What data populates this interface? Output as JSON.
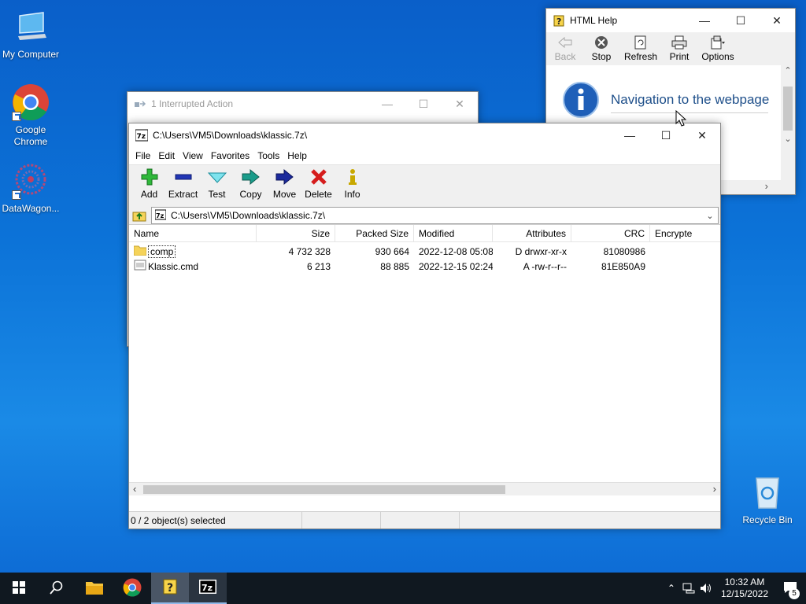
{
  "desktop": {
    "icons": [
      {
        "label": "My Computer"
      },
      {
        "label": "Google Chrome"
      },
      {
        "label": "DataWagon..."
      },
      {
        "label": "Recycle Bin"
      }
    ]
  },
  "html_help": {
    "title": "HTML Help",
    "buttons": [
      {
        "label": "Back",
        "icon": "back-arrow-icon"
      },
      {
        "label": "Stop",
        "icon": "stop-icon"
      },
      {
        "label": "Refresh",
        "icon": "refresh-icon"
      },
      {
        "label": "Print",
        "icon": "printer-icon"
      },
      {
        "label": "Options",
        "icon": "options-icon"
      }
    ],
    "message": "Navigation to the webpage"
  },
  "interrupted": {
    "title": "1 Interrupted Action"
  },
  "sevenzip": {
    "title": "C:\\Users\\VM5\\Downloads\\klassic.7z\\",
    "menu": [
      "File",
      "Edit",
      "View",
      "Favorites",
      "Tools",
      "Help"
    ],
    "toolbar": [
      {
        "label": "Add",
        "icon": "plus-icon",
        "color": "#2fb83a"
      },
      {
        "label": "Extract",
        "icon": "minus-icon",
        "color": "#2136b5"
      },
      {
        "label": "Test",
        "icon": "check-icon",
        "color": "#21b5c5"
      },
      {
        "label": "Copy",
        "icon": "copy-arrow-icon",
        "color": "#1a9c8a"
      },
      {
        "label": "Move",
        "icon": "move-arrow-icon",
        "color": "#1c2a9c"
      },
      {
        "label": "Delete",
        "icon": "delete-x-icon",
        "color": "#d51c1c"
      },
      {
        "label": "Info",
        "icon": "info-icon",
        "color": "#c8a800"
      }
    ],
    "address": "C:\\Users\\VM5\\Downloads\\klassic.7z\\",
    "columns": [
      "Name",
      "Size",
      "Packed Size",
      "Modified",
      "Attributes",
      "CRC",
      "Encrypte"
    ],
    "rows": [
      {
        "name": "comp",
        "size": "4 732 328",
        "packed": "930 664",
        "modified": "2022-12-08 05:08",
        "attributes": "D drwxr-xr-x",
        "crc": "81080986",
        "encrypted": ""
      },
      {
        "name": "Klassic.cmd",
        "size": "6 213",
        "packed": "88 885",
        "modified": "2022-12-15 02:24",
        "attributes": "A -rw-r--r--",
        "crc": "81E850A9",
        "encrypted": ""
      }
    ],
    "status": "0 / 2 object(s) selected"
  },
  "taskbar": {
    "time": "10:32 AM",
    "date": "12/15/2022",
    "notifications": "5"
  }
}
